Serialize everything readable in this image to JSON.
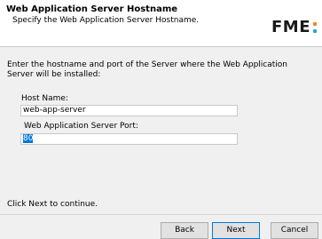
{
  "header": {
    "title": "Web Application Server Hostname",
    "subtitle": "Specify the Web Application Server Hostname.",
    "logo_text": "FME"
  },
  "body": {
    "intro": "Enter the hostname and port of the Server where the Web Application Server will be installed:",
    "host_label": "Host Name:",
    "host_value": "web-app-server",
    "port_label": "Web Application Server Port:",
    "port_value": "80",
    "footer_note": "Click Next to continue."
  },
  "buttons": {
    "back": "Back",
    "next": "Next",
    "cancel": "Cancel"
  },
  "colors": {
    "selection": "#0078d7",
    "logo_dot_orange": "#f58220",
    "logo_dot_blue": "#2aa3d6"
  },
  "icons": [
    "fme-logo-icon"
  ]
}
